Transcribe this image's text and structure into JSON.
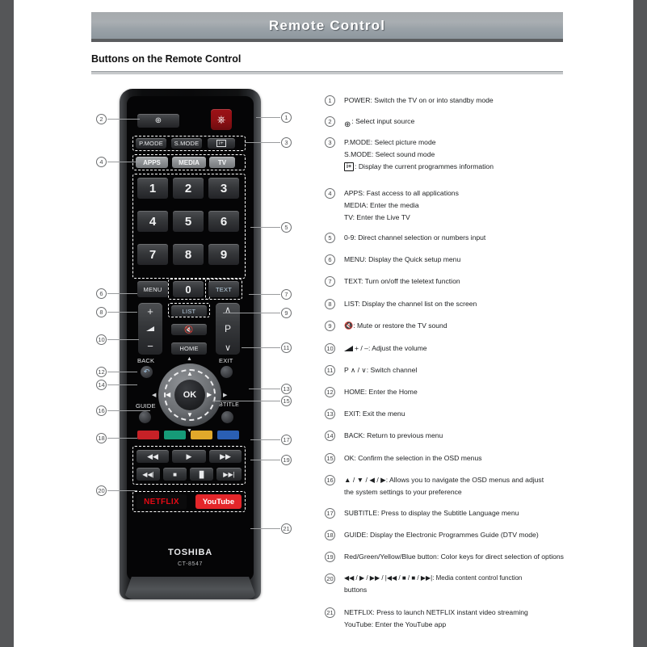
{
  "header": {
    "title": "Remote Control",
    "section_title": "Buttons on the Remote Control"
  },
  "remote": {
    "brand": "TOSHIBA",
    "model": "CT-8547",
    "source_button": "source-icon",
    "power_button": "power-icon",
    "mode_row": [
      "P.MODE",
      "S.MODE",
      "i+"
    ],
    "apps_row": [
      "APPS",
      "MEDIA",
      "TV"
    ],
    "numbers": [
      "1",
      "2",
      "3",
      "4",
      "5",
      "6",
      "7",
      "8",
      "9"
    ],
    "menu": "MENU",
    "zero": "0",
    "text": "TEXT",
    "list": "LIST",
    "mute": "mute-icon",
    "home": "HOME",
    "vol_plus": "+",
    "vol_minus": "−",
    "vol_icon": "volume-icon",
    "ch_up": "∧",
    "ch_label": "P",
    "ch_down": "∨",
    "back": "BACK",
    "exit": "EXIT",
    "guide": "GUIDE",
    "subtitle": "SUBTITLE",
    "ok": "OK",
    "color_keys": [
      {
        "name": "red",
        "hex": "#C62127"
      },
      {
        "name": "green",
        "hex": "#169B78"
      },
      {
        "name": "yellow",
        "hex": "#E0A82B"
      },
      {
        "name": "blue",
        "hex": "#2A5FB4"
      }
    ],
    "media_row1": [
      "◀◀",
      "▶",
      "▶▶"
    ],
    "media_row2": [
      "◀◀|",
      "■",
      "▐▌",
      "▶▶|"
    ],
    "netflix": "NETFLIX",
    "youtube": "YouTube"
  },
  "callouts_left": [
    "2",
    "4",
    "6",
    "8",
    "10",
    "12",
    "14",
    "16",
    "18",
    "20"
  ],
  "callouts_right": [
    "1",
    "3",
    "5",
    "7",
    "9",
    "11",
    "13",
    "15",
    "17",
    "19",
    "21"
  ],
  "legend": [
    {
      "num": "1",
      "lines": [
        "POWER: Switch the TV on or into standby mode"
      ]
    },
    {
      "num": "2",
      "lines": [
        ":   Select input source"
      ],
      "icon": "source"
    },
    {
      "num": "3",
      "lines": [
        "P.MODE: Select picture mode",
        "S.MODE: Select sound mode",
        ":  Display the current programmes information"
      ],
      "icon_line": 2,
      "icon": "info"
    },
    {
      "num": "4",
      "lines": [
        "APPS: Fast access to all applications",
        "MEDIA: Enter the media",
        "TV: Enter the Live TV"
      ]
    },
    {
      "num": "5",
      "lines": [
        "0-9: Direct channel selection or numbers input"
      ]
    },
    {
      "num": "6",
      "lines": [
        "MENU: Display the Quick setup menu"
      ]
    },
    {
      "num": "7",
      "lines": [
        "TEXT: Turn on/off the teletext function"
      ]
    },
    {
      "num": "8",
      "lines": [
        "LIST: Display the channel list on the screen"
      ]
    },
    {
      "num": "9",
      "lines": [
        ": Mute or restore the TV sound"
      ],
      "icon": "mute"
    },
    {
      "num": "10",
      "lines": [
        "+ / –: Adjust the volume"
      ],
      "icon": "volume"
    },
    {
      "num": "11",
      "lines": [
        "P ∧ / ∨: Switch channel"
      ]
    },
    {
      "num": "12",
      "lines": [
        "HOME: Enter the Home"
      ]
    },
    {
      "num": "13",
      "lines": [
        "EXIT: Exit the menu"
      ]
    },
    {
      "num": "14",
      "lines": [
        "BACK: Return to previous menu"
      ]
    },
    {
      "num": "15",
      "lines": [
        "OK: Confirm the selection in the OSD menus"
      ]
    },
    {
      "num": "16",
      "lines": [
        "▲ / ▼ / ◀ / ▶: Allows you to navigate the OSD menus and adjust",
        "the system settings to your preference"
      ]
    },
    {
      "num": "17",
      "lines": [
        "SUBTITLE: Press to display the Subtitle Language menu"
      ]
    },
    {
      "num": "18",
      "lines": [
        "GUIDE: Display the Electronic Programmes Guide (DTV mode)"
      ]
    },
    {
      "num": "19",
      "lines": [
        "Red/Green/Yellow/Blue button: Color keys for direct selection of options"
      ]
    },
    {
      "num": "20",
      "lines": [
        "◀◀ / ▶ / ▶▶ / |◀◀ / ■ / ■ / ▶▶|:  Media content control function",
        "buttons"
      ]
    },
    {
      "num": "21",
      "lines": [
        "NETFLIX: Press to launch NETFLIX instant video streaming",
        "YouTube: Enter the YouTube app"
      ]
    }
  ]
}
